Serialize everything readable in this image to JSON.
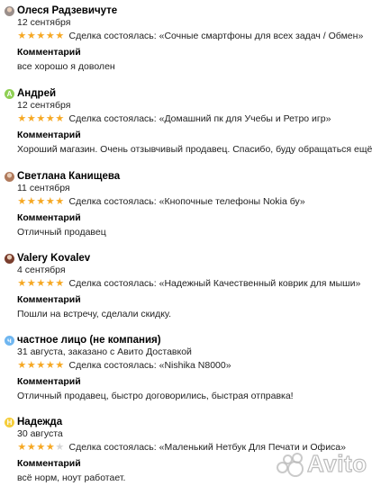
{
  "labels": {
    "comment": "Комментарий",
    "deal_prefix": "Сделка состоялась:"
  },
  "colors": {
    "star_filled": "#F6A823",
    "star_empty": "#D6D6D6"
  },
  "reviews": [
    {
      "name": "Олеся Радзевичуте",
      "avatar": {
        "kind": "photo",
        "color": "#9a8f8b",
        "letter": ""
      },
      "date": "12 сентября",
      "rating": 5,
      "deal": "«Сочные смартфоны для всех задач / Обмен»",
      "comment": "все хорошо я доволен"
    },
    {
      "name": "Андрей",
      "avatar": {
        "kind": "letter",
        "color": "#8fcf54",
        "letter": "А"
      },
      "date": "12 сентября",
      "rating": 5,
      "deal": "«Домашний пк для Учебы и Ретро игр»",
      "comment": "Хороший магазин. Очень отзывчивый продавец. Спасибо, буду обращаться ещё."
    },
    {
      "name": "Светлана Канищева",
      "avatar": {
        "kind": "photo",
        "color": "#b07a5c",
        "letter": ""
      },
      "date": "11 сентября",
      "rating": 5,
      "deal": "«Кнопочные телефоны Nokia бу»",
      "comment": "Отличный продавец"
    },
    {
      "name": "Valery Kovalev",
      "avatar": {
        "kind": "photo",
        "color": "#7a3e2e",
        "letter": ""
      },
      "date": "4 сентября",
      "rating": 5,
      "deal": "«Надежный Качественный коврик для мыши»",
      "comment": "Пошли на встречу, сделали скидку."
    },
    {
      "name": "частное лицо (не компания)",
      "avatar": {
        "kind": "letter",
        "color": "#6fb6f0",
        "letter": "ч"
      },
      "date": "31 августа, заказано с Авито Доставкой",
      "rating": 5,
      "deal": "«Nishika N8000»",
      "comment": "Отличный продавец, быстро договорились, быстрая отправка!"
    },
    {
      "name": "Надежда",
      "avatar": {
        "kind": "letter",
        "color": "#f5cd3a",
        "letter": "Н"
      },
      "date": "30 августа",
      "rating": 4,
      "deal": "«Маленький Нетбук Для Печати и Офиса»",
      "comment": "всё норм, ноут работает."
    }
  ],
  "watermark": {
    "text": "Avito",
    "dot_colors": [
      "#9a9a9a",
      "#9a9a9a",
      "#9a9a9a",
      "#9a9a9a"
    ]
  }
}
